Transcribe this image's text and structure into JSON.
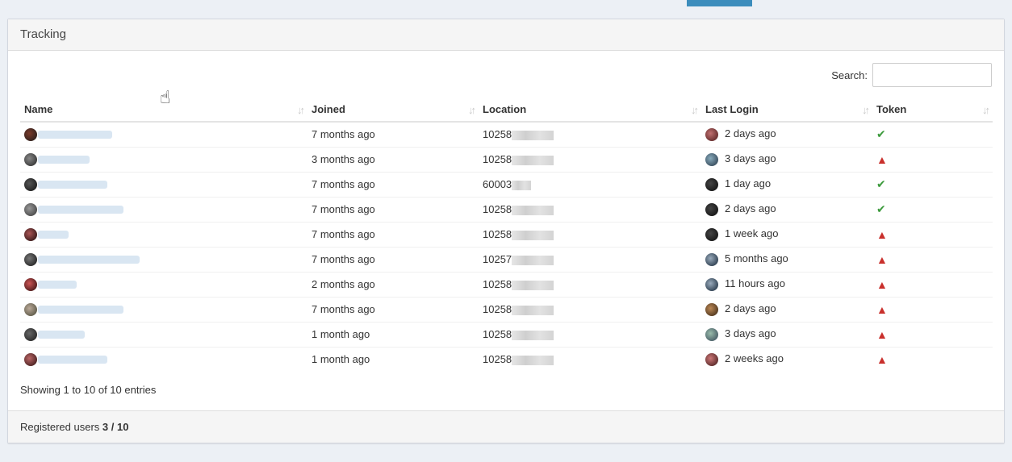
{
  "panel": {
    "title": "Tracking",
    "search_label": "Search:",
    "search_value": ""
  },
  "table": {
    "columns": [
      "Name",
      "Joined",
      "Location",
      "Last Login",
      "Token"
    ],
    "sort_glyph": "↓↑",
    "rows": [
      {
        "joined": "7 months ago",
        "location": "10258",
        "last_login": "2 days ago",
        "token": "✔",
        "token_state": "ok"
      },
      {
        "joined": "3 months ago",
        "location": "10258",
        "last_login": "3 days ago",
        "token": "▲",
        "token_state": "warning"
      },
      {
        "joined": "7 months ago",
        "location": "60003",
        "last_login": "1 day ago",
        "token": "✔",
        "token_state": "ok"
      },
      {
        "joined": "7 months ago",
        "location": "10258",
        "last_login": "2 days ago",
        "token": "✔",
        "token_state": "ok"
      },
      {
        "joined": "7 months ago",
        "location": "10258",
        "last_login": "1 week ago",
        "token": "▲",
        "token_state": "warning"
      },
      {
        "joined": "7 months ago",
        "location": "10257",
        "last_login": "5 months ago",
        "token": "▲",
        "token_state": "warning"
      },
      {
        "joined": "2 months ago",
        "location": "10258",
        "last_login": "11 hours ago",
        "token": "▲",
        "token_state": "warning"
      },
      {
        "joined": "7 months ago",
        "location": "10258",
        "last_login": "2 days ago",
        "token": "▲",
        "token_state": "warning"
      },
      {
        "joined": "1 month ago",
        "location": "10258",
        "last_login": "3 days ago",
        "token": "▲",
        "token_state": "warning"
      },
      {
        "joined": "1 month ago",
        "location": "10258",
        "last_login": "2 weeks ago",
        "token": "▲",
        "token_state": "warning"
      }
    ]
  },
  "info_text": "Showing 1 to 10 of 10 entries",
  "footer": {
    "label": "Registered users",
    "count": "3 / 10"
  },
  "colors": {
    "ok": "#3c9a3c",
    "warning": "#c9302c",
    "accent": "#3c8dbc"
  },
  "icons": {
    "ok": "check-icon",
    "warning": "warning-triangle-icon",
    "sort": "sort-icon",
    "cursor": "hand-cursor-icon"
  }
}
